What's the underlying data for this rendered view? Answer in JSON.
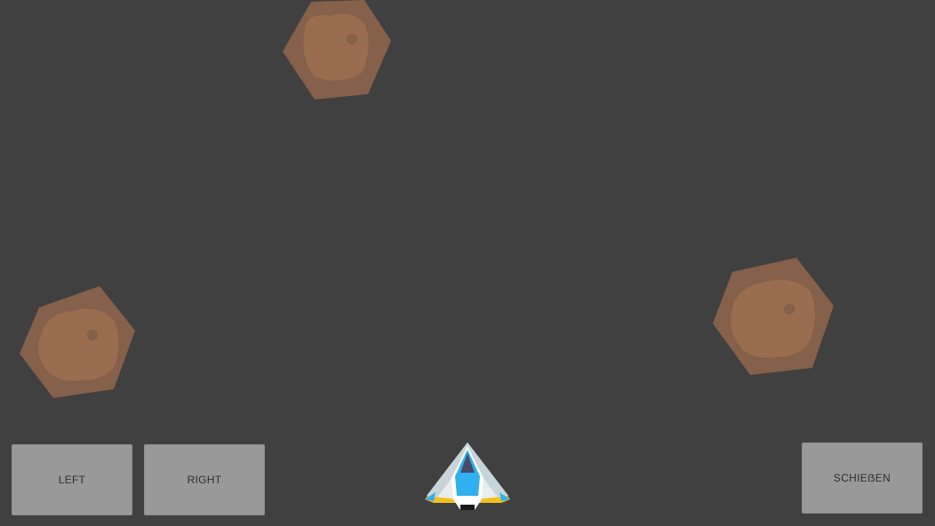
{
  "controls": {
    "left_label": "LEFT",
    "right_label": "RIGHT",
    "shoot_label": "SCHIEẞEN"
  },
  "colors": {
    "background": "#404040",
    "button_fill": "#999999",
    "asteroid_outer": "#85604a",
    "asteroid_inner": "#9a6d50",
    "ship_body": "#e8eef0",
    "ship_accent": "#2fb0ef",
    "ship_cockpit": "#4a4a6a",
    "ship_trim": "#f0c020"
  },
  "sprites": {
    "asteroids": [
      "asteroid",
      "asteroid",
      "asteroid"
    ],
    "player": "spaceship"
  }
}
